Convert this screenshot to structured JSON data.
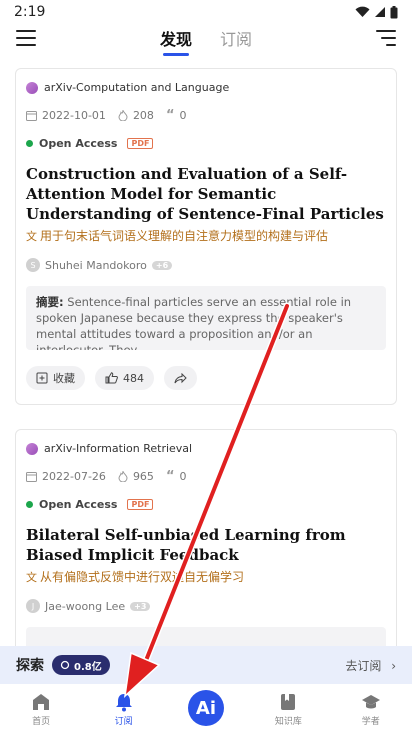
{
  "status": {
    "time": "2:19"
  },
  "header": {
    "tabs": [
      {
        "label": "发现",
        "active": true
      },
      {
        "label": "订阅",
        "active": false
      }
    ]
  },
  "cards": [
    {
      "source": "arXiv-Computation and Language",
      "date": "2022-10-01",
      "views": "208",
      "cites": "0",
      "access": "Open Access",
      "pdf_tag": "PDF",
      "title": "Construction and Evaluation of a Self-Attention Model for Semantic Understanding of Sentence-Final Particles",
      "subtitle": "用于句末话气词语义理解的自注意力模型的构建与评估",
      "author_initial": "S",
      "author": "Shuhei Mandokoro",
      "more_authors": "+6",
      "abstract_label": "摘要:",
      "abstract": "Sentence-final particles serve an essential role in spoken Japanese because they express the speaker's mental attitudes toward a proposition and/or an interlocutor. They ...",
      "actions": {
        "save": "收藏",
        "likes": "484"
      }
    },
    {
      "source": "arXiv-Information Retrieval",
      "date": "2022-07-26",
      "views": "965",
      "cites": "0",
      "access": "Open Access",
      "pdf_tag": "PDF",
      "title": "Bilateral Self-unbiased Learning from Biased Implicit Feedback",
      "subtitle": "从有偏隐式反馈中进行双边自无偏学习",
      "author_initial": "J",
      "author": "Jae-woong Lee",
      "more_authors": "+3"
    }
  ],
  "explore": {
    "label": "探索",
    "count": "0.8亿",
    "subscribe_link": "去订阅"
  },
  "bottom_nav": [
    {
      "label": "首页",
      "icon": "home-icon",
      "active": false
    },
    {
      "label": "订阅",
      "icon": "bell-icon",
      "active": true
    },
    {
      "label": "Ai",
      "icon": "ai-icon",
      "active": false
    },
    {
      "label": "知识库",
      "icon": "bookmark-icon",
      "active": false
    },
    {
      "label": "学者",
      "icon": "scholar-icon",
      "active": false
    }
  ],
  "colors": {
    "accent": "#2a53e8",
    "annotation_arrow": "#e02020"
  }
}
